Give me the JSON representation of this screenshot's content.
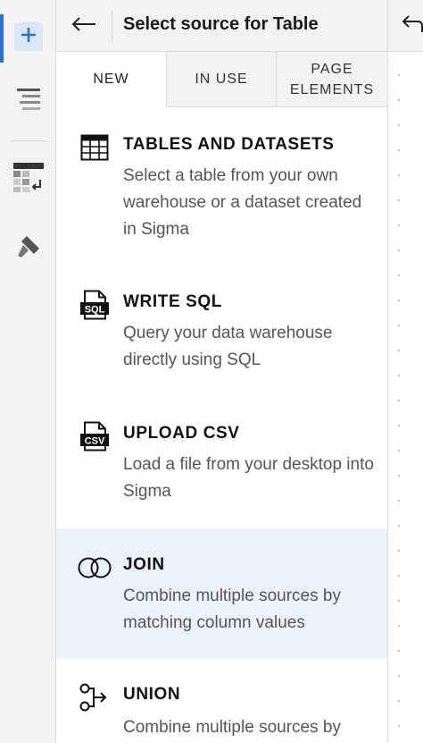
{
  "header": {
    "title": "Select source for Table",
    "back_icon": "arrow-left-icon"
  },
  "rail": {
    "items": [
      {
        "name": "add",
        "icon": "plus-icon",
        "active": true
      },
      {
        "name": "outline",
        "icon": "lines-icon",
        "active": false
      },
      {
        "name": "format",
        "icon": "table-format-icon",
        "active": false
      },
      {
        "name": "style",
        "icon": "paintbrush-icon",
        "active": false
      }
    ],
    "accent_color": "#2f6fd1"
  },
  "tabs": [
    {
      "label": "NEW",
      "active": true
    },
    {
      "label": "IN USE",
      "active": false
    },
    {
      "label": "PAGE ELEMENTS",
      "active": false
    }
  ],
  "sources": [
    {
      "title": "TABLES AND DATASETS",
      "description": "Select a table from your own warehouse or a dataset created in Sigma",
      "icon": "table-grid-icon"
    },
    {
      "title": "WRITE SQL",
      "description": "Query your data warehouse directly using SQL",
      "icon": "sql-file-icon",
      "icon_text": "SQL"
    },
    {
      "title": "UPLOAD CSV",
      "description": "Load a file from your desktop into Sigma",
      "icon": "csv-file-icon",
      "icon_text": "CSV"
    },
    {
      "title": "JOIN",
      "description": "Combine multiple sources by matching column values",
      "icon": "join-icon",
      "highlighted": true
    },
    {
      "title": "UNION",
      "description": "Combine multiple sources by",
      "icon": "union-icon"
    }
  ],
  "colors": {
    "highlight": "#eaf2fb",
    "rail_background": "#f3f3f3"
  }
}
